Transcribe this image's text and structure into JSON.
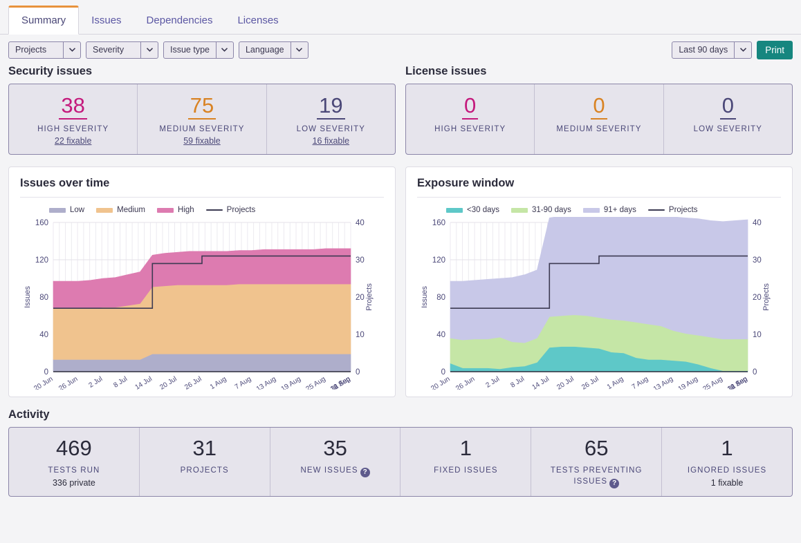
{
  "tabs": [
    {
      "label": "Summary",
      "active": true
    },
    {
      "label": "Issues",
      "active": false
    },
    {
      "label": "Dependencies",
      "active": false
    },
    {
      "label": "Licenses",
      "active": false
    }
  ],
  "filters": [
    {
      "label": "Projects"
    },
    {
      "label": "Severity"
    },
    {
      "label": "Issue type"
    },
    {
      "label": "Language"
    }
  ],
  "date_range": {
    "label": "Last 90 days"
  },
  "print_button": {
    "label": "Print"
  },
  "security_issues": {
    "heading": "Security issues",
    "cells": [
      {
        "value": "38",
        "label": "HIGH SEVERITY",
        "fixable": "22 fixable",
        "color": "#c4197c"
      },
      {
        "value": "75",
        "label": "MEDIUM SEVERITY",
        "fixable": "59 fixable",
        "color": "#d98324"
      },
      {
        "value": "19",
        "label": "LOW SEVERITY",
        "fixable": "16 fixable",
        "color": "#4b4878"
      }
    ]
  },
  "license_issues": {
    "heading": "License issues",
    "cells": [
      {
        "value": "0",
        "label": "HIGH SEVERITY",
        "fixable": "",
        "color": "#c4197c"
      },
      {
        "value": "0",
        "label": "MEDIUM SEVERITY",
        "fixable": "",
        "color": "#d98324"
      },
      {
        "value": "0",
        "label": "LOW SEVERITY",
        "fixable": "",
        "color": "#4b4878"
      }
    ]
  },
  "activity": {
    "heading": "Activity",
    "cells": [
      {
        "value": "469",
        "label": "TESTS RUN",
        "sub": "336 private",
        "help": false
      },
      {
        "value": "31",
        "label": "PROJECTS",
        "sub": "",
        "help": false
      },
      {
        "value": "35",
        "label": "NEW ISSUES",
        "sub": "",
        "help": true
      },
      {
        "value": "1",
        "label": "FIXED ISSUES",
        "sub": "",
        "help": false
      },
      {
        "value": "65",
        "label": "TESTS PREVENTING ISSUES",
        "sub": "",
        "help": true
      },
      {
        "value": "1",
        "label": "IGNORED ISSUES",
        "sub": "1 fixable",
        "help": false
      }
    ]
  },
  "chart_data": [
    {
      "type": "area",
      "title": "Issues over time",
      "stacked": true,
      "xlabel": "",
      "ylabel": "Issues",
      "ylim": [
        0,
        160
      ],
      "yticks": [
        0,
        40,
        80,
        120,
        160
      ],
      "y2label": "Projects",
      "y2lim": [
        0,
        40
      ],
      "y2ticks": [
        0,
        10,
        20,
        30,
        40
      ],
      "grid": true,
      "legend_position": "top",
      "x": [
        "20 Jun",
        "26 Jun",
        "2 Jul",
        "8 Jul",
        "14 Jul",
        "20 Jul",
        "26 Jul",
        "1 Aug",
        "7 Aug",
        "13 Aug",
        "19 Aug",
        "25 Aug",
        "31 Aug",
        "6 Sep",
        "12 Sep"
      ],
      "series": [
        {
          "name": "Low",
          "color": "#aeaecb",
          "values": [
            13,
            13,
            13,
            13,
            13,
            13,
            13,
            13,
            19,
            19,
            19,
            19,
            19,
            19,
            19,
            19,
            19,
            19,
            19,
            19,
            19,
            19,
            19,
            19,
            19
          ]
        },
        {
          "name": "Medium",
          "color": "#f0c38e",
          "values": [
            55,
            55,
            55,
            55,
            56,
            56,
            58,
            60,
            72,
            73,
            74,
            74,
            74,
            74,
            74,
            75,
            75,
            75,
            75,
            75,
            75,
            75,
            75,
            75,
            75
          ]
        },
        {
          "name": "High",
          "color": "#dd7bb0",
          "values": [
            29,
            29,
            29,
            30,
            31,
            32,
            33,
            34,
            34,
            35,
            35,
            36,
            36,
            36,
            36,
            36,
            36,
            37,
            37,
            37,
            37,
            37,
            38,
            38,
            38
          ]
        }
      ],
      "line_series": {
        "name": "Projects",
        "color": "#3c3a52",
        "axis": "right",
        "values": [
          17,
          17,
          17,
          17,
          17,
          17,
          17,
          17,
          29,
          29,
          29,
          29,
          31,
          31,
          31,
          31,
          31,
          31,
          31,
          31,
          31,
          31,
          31,
          31,
          31
        ]
      }
    },
    {
      "type": "area",
      "title": "Exposure window",
      "stacked": true,
      "xlabel": "",
      "ylabel": "Issues",
      "ylim": [
        0,
        160
      ],
      "yticks": [
        0,
        40,
        80,
        120,
        160
      ],
      "y2label": "Projects",
      "y2lim": [
        0,
        40
      ],
      "y2ticks": [
        0,
        10,
        20,
        30,
        40
      ],
      "grid": true,
      "legend_position": "top",
      "x": [
        "20 Jun",
        "26 Jun",
        "2 Jul",
        "8 Jul",
        "14 Jul",
        "20 Jul",
        "26 Jul",
        "1 Aug",
        "7 Aug",
        "13 Aug",
        "19 Aug",
        "25 Aug",
        "31 Aug",
        "6 Sep",
        "12 Sep"
      ],
      "series": [
        {
          "name": "<30 days",
          "color": "#5ec8c8",
          "values": [
            9,
            4,
            4,
            4,
            3,
            5,
            6,
            10,
            26,
            27,
            27,
            26,
            25,
            21,
            20,
            15,
            13,
            13,
            12,
            11,
            8,
            4,
            1,
            1,
            1
          ]
        },
        {
          "name": "31-90 days",
          "color": "#c5e6a6",
          "values": [
            27,
            30,
            31,
            31,
            34,
            27,
            25,
            26,
            33,
            33,
            34,
            34,
            33,
            35,
            35,
            38,
            38,
            36,
            32,
            30,
            31,
            33,
            34,
            34,
            34
          ]
        },
        {
          "name": "91+ days",
          "color": "#c8c8e8",
          "values": [
            61,
            63,
            63,
            64,
            63,
            69,
            73,
            73,
            106,
            107,
            107,
            108,
            111,
            113,
            114,
            114,
            116,
            117,
            122,
            124,
            125,
            125,
            126,
            127,
            128
          ]
        }
      ],
      "line_series": {
        "name": "Projects",
        "color": "#3c3a52",
        "axis": "right",
        "values": [
          17,
          17,
          17,
          17,
          17,
          17,
          17,
          17,
          29,
          29,
          29,
          29,
          31,
          31,
          31,
          31,
          31,
          31,
          31,
          31,
          31,
          31,
          31,
          31,
          31
        ]
      }
    }
  ]
}
